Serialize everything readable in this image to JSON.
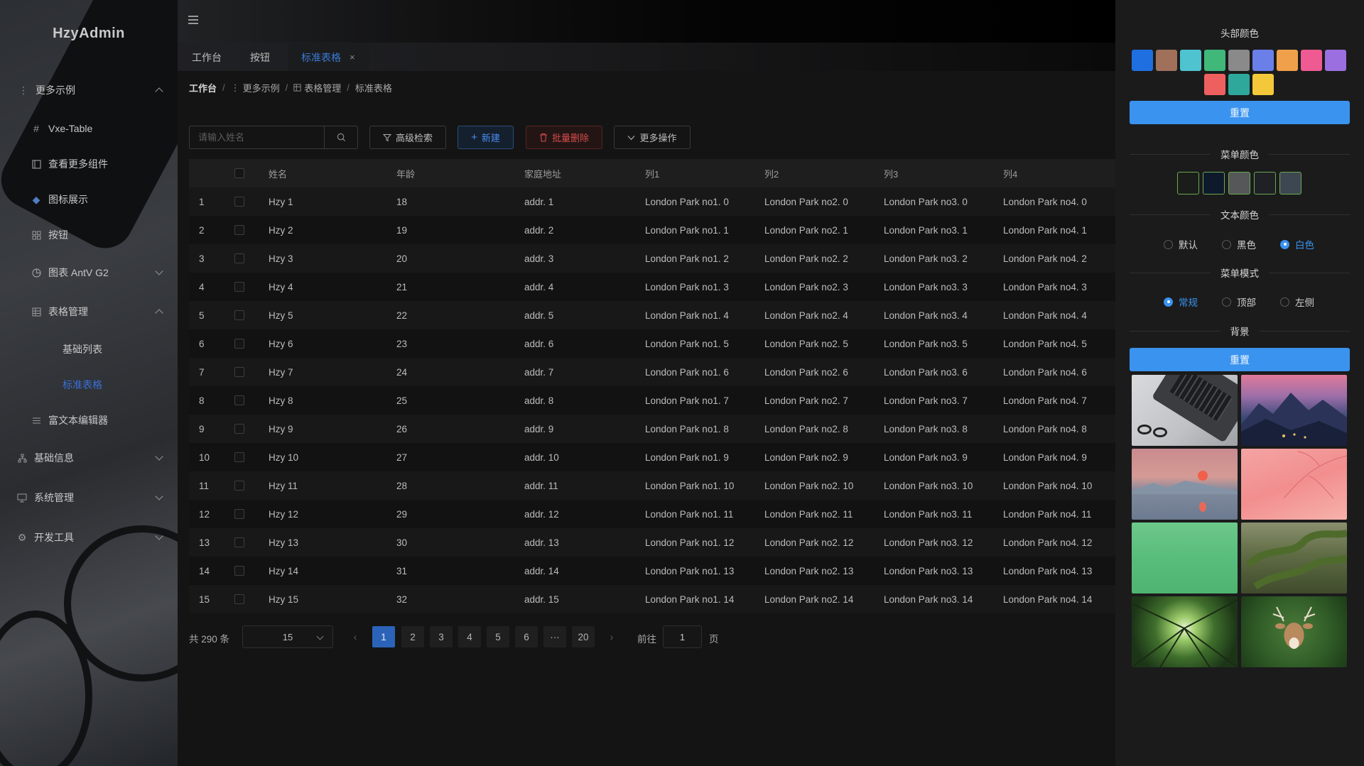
{
  "app": {
    "logo": "HzyAdmin"
  },
  "sidebar": {
    "items": [
      {
        "label": "更多示例",
        "icon": "dots-vertical-icon",
        "level": 1,
        "expanded": true
      },
      {
        "label": "Vxe-Table",
        "icon": "hash-icon",
        "level": 2
      },
      {
        "label": "查看更多组件",
        "icon": "book-icon",
        "level": 2
      },
      {
        "label": "图标展示",
        "icon": "diamond-icon",
        "level": 2
      },
      {
        "label": "按钮",
        "icon": "grid-icon",
        "level": 2
      },
      {
        "label": "图表 AntV G2",
        "icon": "pie-chart-icon",
        "level": 2,
        "expanded": false
      },
      {
        "label": "表格管理",
        "icon": "table-icon",
        "level": 2,
        "expanded": true
      },
      {
        "label": "基础列表",
        "level": 3
      },
      {
        "label": "标准表格",
        "level": 3,
        "active": true
      },
      {
        "label": "富文本编辑器",
        "icon": "list-icon",
        "level": 2
      },
      {
        "label": "基础信息",
        "icon": "org-icon",
        "level": 1,
        "expanded": false
      },
      {
        "label": "系统管理",
        "icon": "monitor-icon",
        "level": 1,
        "expanded": false
      },
      {
        "label": "开发工具",
        "icon": "gear-icon",
        "level": 1,
        "expanded": false
      }
    ]
  },
  "tabs": [
    {
      "label": "工作台"
    },
    {
      "label": "按钮"
    },
    {
      "label": "标准表格",
      "active": true,
      "close": "×"
    }
  ],
  "breadcrumb": [
    "工作台",
    "更多示例",
    "表格管理",
    "标准表格"
  ],
  "toolbar": {
    "search_placeholder": "请输入姓名",
    "advanced_search": "高级检索",
    "add": "新建",
    "batch_delete": "批量删除",
    "more_actions": "更多操作"
  },
  "table": {
    "columns": [
      "姓名",
      "年龄",
      "家庭地址",
      "列1",
      "列2",
      "列3",
      "列4"
    ],
    "rows": [
      [
        "1",
        "Hzy 1",
        "18",
        "addr. 1",
        "London Park no1. 0",
        "London Park no2. 0",
        "London Park no3. 0",
        "London Park no4. 0"
      ],
      [
        "2",
        "Hzy 2",
        "19",
        "addr. 2",
        "London Park no1. 1",
        "London Park no2. 1",
        "London Park no3. 1",
        "London Park no4. 1"
      ],
      [
        "3",
        "Hzy 3",
        "20",
        "addr. 3",
        "London Park no1. 2",
        "London Park no2. 2",
        "London Park no3. 2",
        "London Park no4. 2"
      ],
      [
        "4",
        "Hzy 4",
        "21",
        "addr. 4",
        "London Park no1. 3",
        "London Park no2. 3",
        "London Park no3. 3",
        "London Park no4. 3"
      ],
      [
        "5",
        "Hzy 5",
        "22",
        "addr. 5",
        "London Park no1. 4",
        "London Park no2. 4",
        "London Park no3. 4",
        "London Park no4. 4"
      ],
      [
        "6",
        "Hzy 6",
        "23",
        "addr. 6",
        "London Park no1. 5",
        "London Park no2. 5",
        "London Park no3. 5",
        "London Park no4. 5"
      ],
      [
        "7",
        "Hzy 7",
        "24",
        "addr. 7",
        "London Park no1. 6",
        "London Park no2. 6",
        "London Park no3. 6",
        "London Park no4. 6"
      ],
      [
        "8",
        "Hzy 8",
        "25",
        "addr. 8",
        "London Park no1. 7",
        "London Park no2. 7",
        "London Park no3. 7",
        "London Park no4. 7"
      ],
      [
        "9",
        "Hzy 9",
        "26",
        "addr. 9",
        "London Park no1. 8",
        "London Park no2. 8",
        "London Park no3. 8",
        "London Park no4. 8"
      ],
      [
        "10",
        "Hzy 10",
        "27",
        "addr. 10",
        "London Park no1. 9",
        "London Park no2. 9",
        "London Park no3. 9",
        "London Park no4. 9"
      ],
      [
        "11",
        "Hzy 11",
        "28",
        "addr. 11",
        "London Park no1. 10",
        "London Park no2. 10",
        "London Park no3. 10",
        "London Park no4. 10"
      ],
      [
        "12",
        "Hzy 12",
        "29",
        "addr. 12",
        "London Park no1. 11",
        "London Park no2. 11",
        "London Park no3. 11",
        "London Park no4. 11"
      ],
      [
        "13",
        "Hzy 13",
        "30",
        "addr. 13",
        "London Park no1. 12",
        "London Park no2. 12",
        "London Park no3. 12",
        "London Park no4. 12"
      ],
      [
        "14",
        "Hzy 14",
        "31",
        "addr. 14",
        "London Park no1. 13",
        "London Park no2. 13",
        "London Park no3. 13",
        "London Park no4. 13"
      ],
      [
        "15",
        "Hzy 15",
        "32",
        "addr. 15",
        "London Park no1. 14",
        "London Park no2. 14",
        "London Park no3. 14",
        "London Park no4. 14"
      ]
    ]
  },
  "pagination": {
    "total_label": "共 290 条",
    "page_size": "15",
    "pages": [
      "1",
      "2",
      "3",
      "4",
      "5",
      "6",
      "···",
      "20"
    ],
    "current": "1",
    "goto_prefix": "前往",
    "goto_value": "1",
    "goto_suffix": "页",
    "prev": "‹",
    "next": "›"
  },
  "settings": {
    "header_color_title": "头部颜色",
    "header_colors": [
      "#1f6fe0",
      "#a0705a",
      "#4fc3d0",
      "#3fb87a",
      "#8a8a8a",
      "#6b7fe8",
      "#f0a04a",
      "#ee5a91",
      "#9b6fe0",
      "#ee6060",
      "#2ea89a",
      "#f3c93a"
    ],
    "reset_label": "重置",
    "menu_color_title": "菜单颜色",
    "menu_colors": [
      "#1a1d1a",
      "#0e1a2c",
      "#555759",
      "#1f2126",
      "#3d4752"
    ],
    "text_color_title": "文本颜色",
    "text_options": [
      {
        "label": "默认",
        "selected": false
      },
      {
        "label": "黑色",
        "selected": false
      },
      {
        "label": "白色",
        "selected": true
      }
    ],
    "menu_mode_title": "菜单模式",
    "menu_modes": [
      {
        "label": "常规",
        "selected": true
      },
      {
        "label": "顶部",
        "selected": false
      },
      {
        "label": "左侧",
        "selected": false
      }
    ],
    "background_title": "背景",
    "backgrounds": [
      "laptop",
      "mountain-night",
      "pink-sunset",
      "pink-branches",
      "green-gradient",
      "mossy-tree",
      "forest-canopy",
      "deer"
    ]
  }
}
